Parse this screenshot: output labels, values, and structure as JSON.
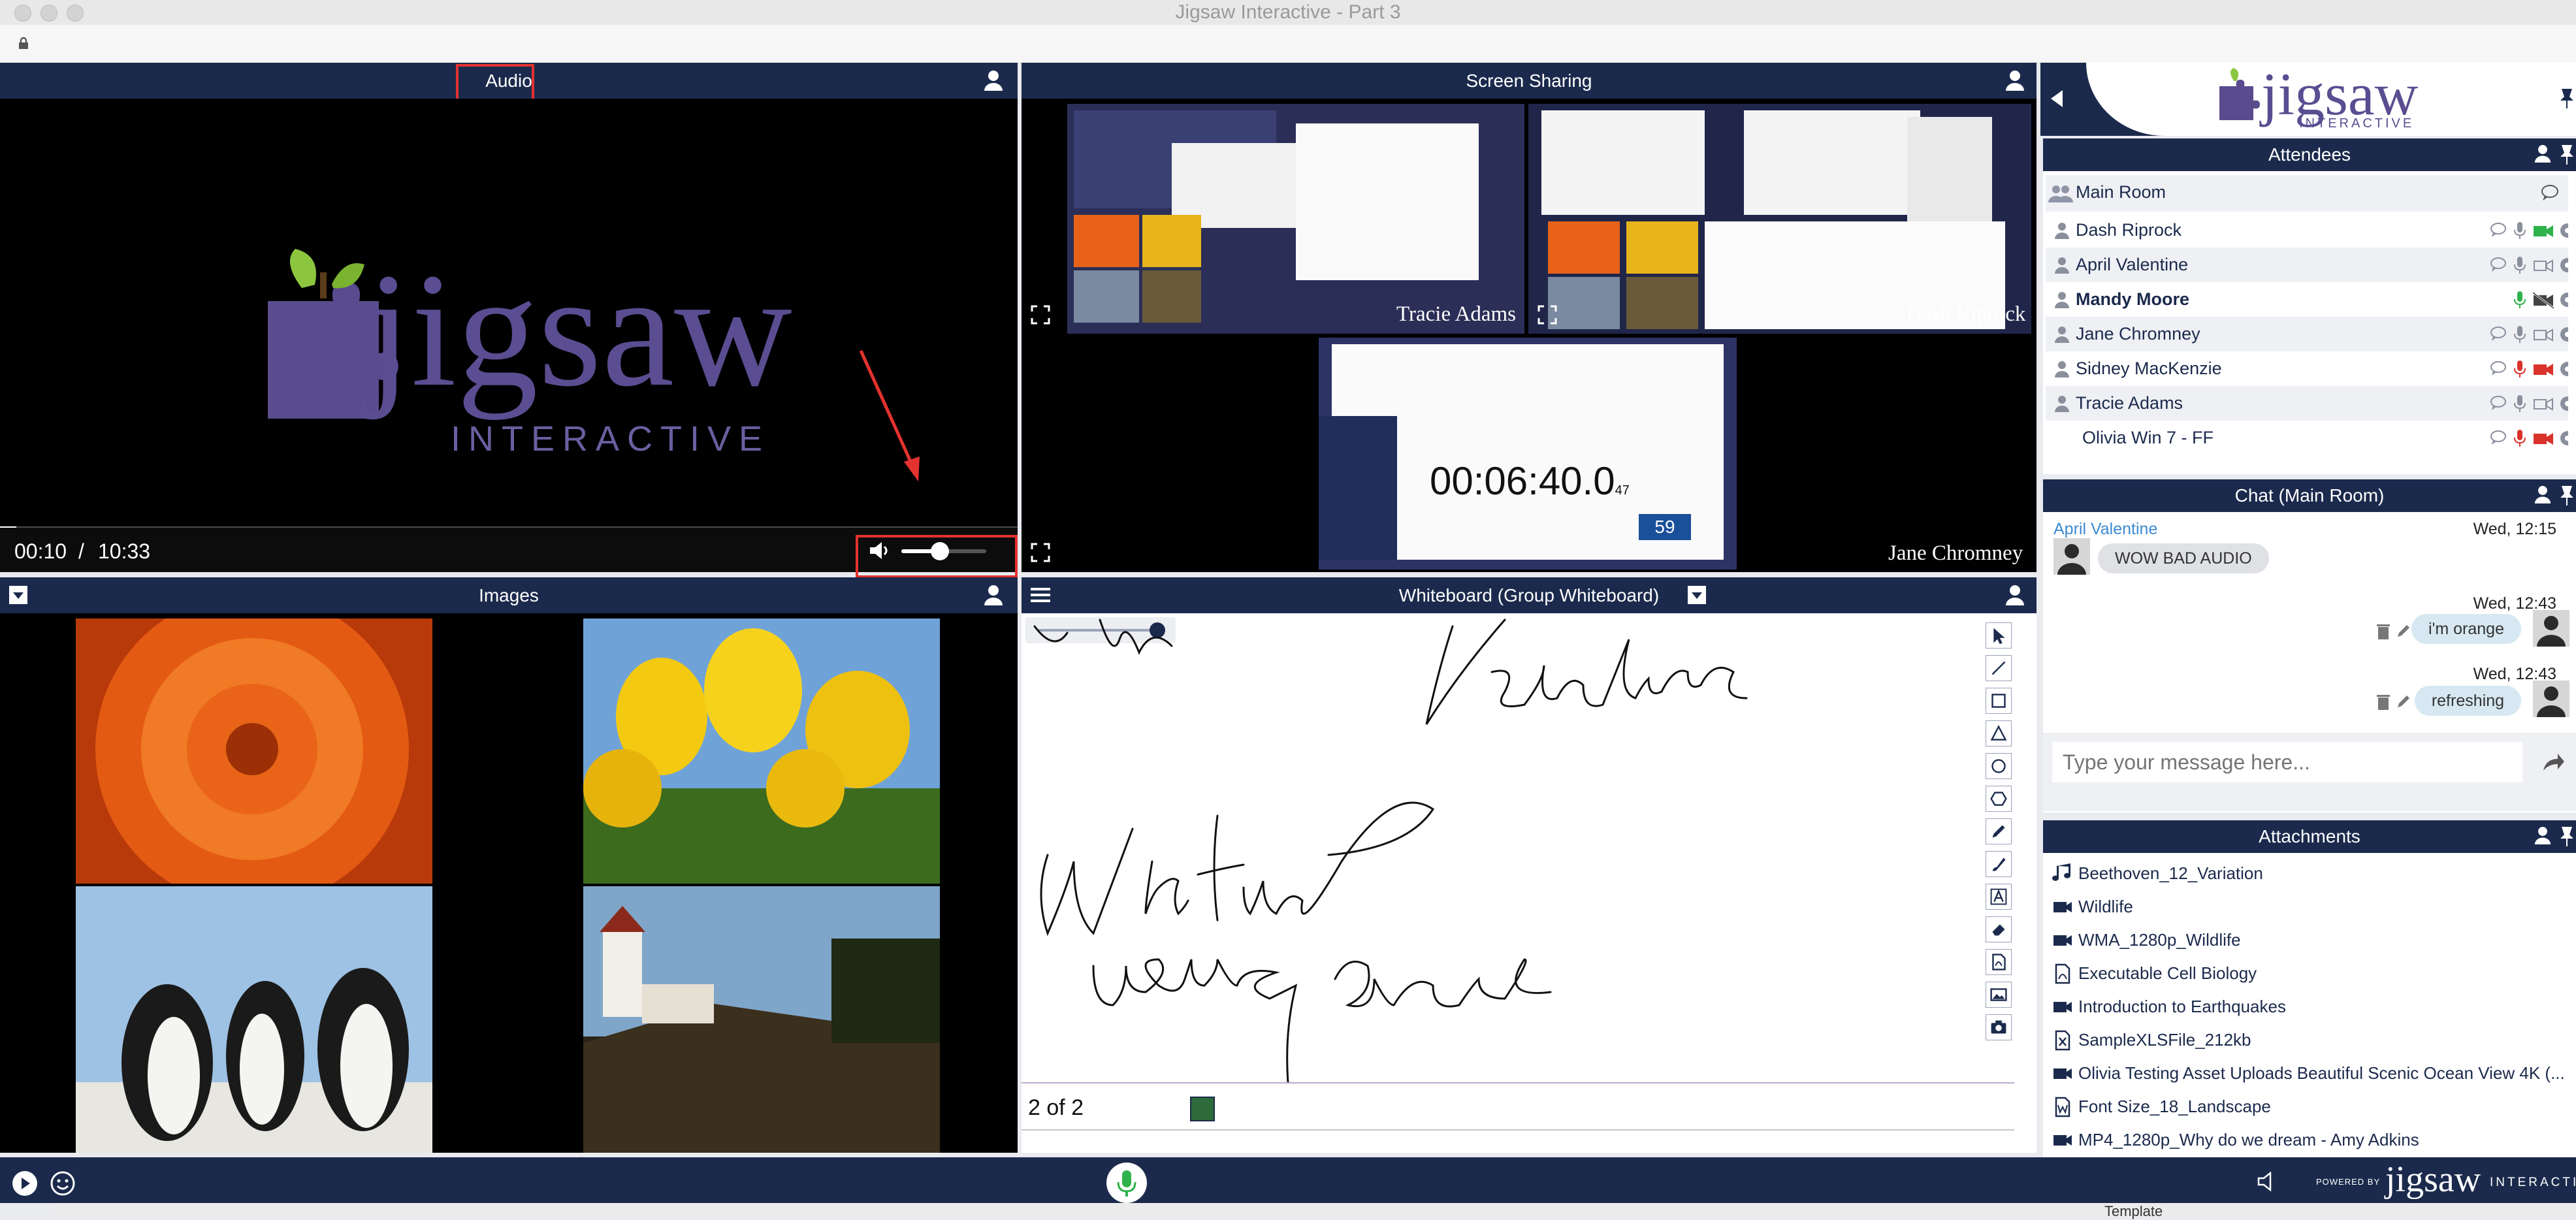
{
  "window": {
    "title": "Jigsaw Interactive - Part 3"
  },
  "audio_panel": {
    "title": "Audio",
    "logo_word": "jigsaw",
    "logo_sub": "INTERACTIVE",
    "current_time": "00:10",
    "separator": "/",
    "duration": "10:33",
    "progress": 0.016,
    "volume": 0.45
  },
  "screen_panel": {
    "title": "Screen Sharing",
    "tiles": [
      "Tracie Adams",
      "Dash Riprock",
      "Jane Chromney"
    ],
    "inner_timer": "00:06:40.0",
    "inner_timer_small": "47",
    "inner_badge": "59"
  },
  "images_panel": {
    "title": "Images"
  },
  "whiteboard": {
    "title": "Whiteboard (Group Whiteboard)",
    "page_indicator": "2 of 2",
    "tools": [
      "select-icon",
      "line-icon",
      "rectangle-icon",
      "triangle-icon",
      "circle-icon",
      "hexagon-icon",
      "pen-icon",
      "brush-icon",
      "text-icon",
      "eraser-icon",
      "pdf-icon",
      "image-icon",
      "camera-icon"
    ]
  },
  "sidebar": {
    "logo_word": "jigsaw",
    "logo_sub": "INTERACTIVE",
    "attendees_title": "Attendees",
    "room": "Main Room",
    "attendees": [
      {
        "name": "Dash Riprock",
        "bold": false,
        "mic": "normal",
        "cam": "green"
      },
      {
        "name": "April Valentine",
        "bold": false,
        "mic": "normal",
        "cam": "off"
      },
      {
        "name": "Mandy Moore",
        "bold": true,
        "mic": "green",
        "cam": "crossed"
      },
      {
        "name": "Jane Chromney",
        "bold": false,
        "mic": "normal",
        "cam": "off"
      },
      {
        "name": "Sidney MacKenzie",
        "bold": false,
        "mic": "red",
        "cam": "red"
      },
      {
        "name": "Tracie Adams",
        "bold": false,
        "mic": "normal",
        "cam": "off"
      },
      {
        "name": "Olivia Win 7 - FF",
        "bold": false,
        "mic": "red",
        "cam": "red"
      }
    ],
    "chat_title": "Chat (Main Room)",
    "chat": {
      "sender": "April Valentine",
      "m1_time": "Wed, 12:15",
      "m1_text": "WOW BAD AUDIO",
      "m2_time": "Wed, 12:43",
      "m2_text": "i'm orange",
      "m3_time": "Wed, 12:43",
      "m3_text": "refreshing",
      "input_placeholder": "Type your message here..."
    },
    "attachments_title": "Attachments",
    "attachments": [
      {
        "name": "Beethoven_12_Variation",
        "icon": "music-icon"
      },
      {
        "name": "Wildlife",
        "icon": "video-icon"
      },
      {
        "name": "WMA_1280p_Wildlife",
        "icon": "video-icon"
      },
      {
        "name": "Executable Cell Biology",
        "icon": "pdf-icon"
      },
      {
        "name": "Introduction to Earthquakes",
        "icon": "video-icon"
      },
      {
        "name": "SampleXLSFile_212kb",
        "icon": "excel-icon"
      },
      {
        "name": "Olivia Testing Asset Uploads Beautiful Scenic Ocean View 4K (...",
        "icon": "video-icon"
      },
      {
        "name": "Font Size_18_Landscape",
        "icon": "word-icon"
      },
      {
        "name": "MP4_1280p_Why do we dream - Amy Adkins",
        "icon": "video-icon"
      }
    ],
    "peek_text": "Template"
  },
  "bottombar": {
    "powered_by": "POWERED BY",
    "brand": "jigsaw",
    "brand_sub": "INTERACTIVE"
  },
  "colors": {
    "navy": "#1b2a4c",
    "accent_red": "#e3322f",
    "chat_bubble": "#d7e8f2",
    "mic_green": "#2fb24c"
  }
}
